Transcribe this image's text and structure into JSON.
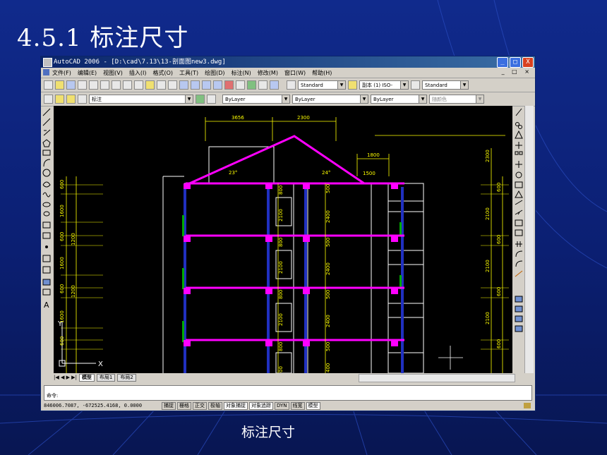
{
  "slide": {
    "title": "4.5.1 标注尺寸",
    "caption": "标注尺寸"
  },
  "window": {
    "title": "AutoCAD 2006 - [D:\\cad\\7.13\\13-剖面图new3.dwg]",
    "buttons": [
      "_",
      "□",
      "X"
    ]
  },
  "menus": [
    "文件(F)",
    "编辑(E)",
    "视图(V)",
    "插入(I)",
    "格式(O)",
    "工具(T)",
    "绘图(D)",
    "标注(N)",
    "修改(M)",
    "窗口(W)",
    "帮助(H)"
  ],
  "toolbar": {
    "text_style": "Standard",
    "dim_style": "副本 (1) ISO-",
    "table_style": "Standard",
    "layer": "标注",
    "color": "ByLayer",
    "linetype": "ByLayer",
    "lineweight": "ByLayer",
    "plotstyle": "随颜色"
  },
  "drawing": {
    "top_dims": [
      "3656",
      "2300",
      "1800"
    ],
    "left_dims": [
      "600",
      "1600",
      "600",
      "1600",
      "600",
      "1600",
      "600"
    ],
    "left_dims2": [
      "1200",
      "1200"
    ],
    "right_dims": [
      "2300",
      "600",
      "2100",
      "600",
      "2100",
      "600",
      "2100",
      "600"
    ],
    "floor_dims": [
      "800",
      "2100",
      "800",
      "2100",
      "800",
      "2100",
      "800",
      "00"
    ],
    "mid_dims": [
      "500",
      "2400",
      "500",
      "2400",
      "500",
      "2400",
      "500",
      "400"
    ],
    "roof_dims": [
      "23°",
      "24°",
      "1500"
    ],
    "axis_y": "Y",
    "axis_x": "X"
  },
  "tabs": [
    "模型",
    "布局1",
    "布局2"
  ],
  "command": {
    "prompt": "命令:"
  },
  "status": {
    "coords": "846006.7087, -672525.4168, 0.0000",
    "buttons": [
      "捕捉",
      "栅格",
      "正交",
      "极轴",
      "对象捕捉",
      "对象追踪",
      "DYN",
      "线宽",
      "模型"
    ]
  },
  "colors": {
    "slide_bg": "#0b1f72",
    "magenta": "#ff00ff",
    "dim_yellow": "#ffff00",
    "wall_white": "#ffffff",
    "window_blue": "#2030c0"
  }
}
